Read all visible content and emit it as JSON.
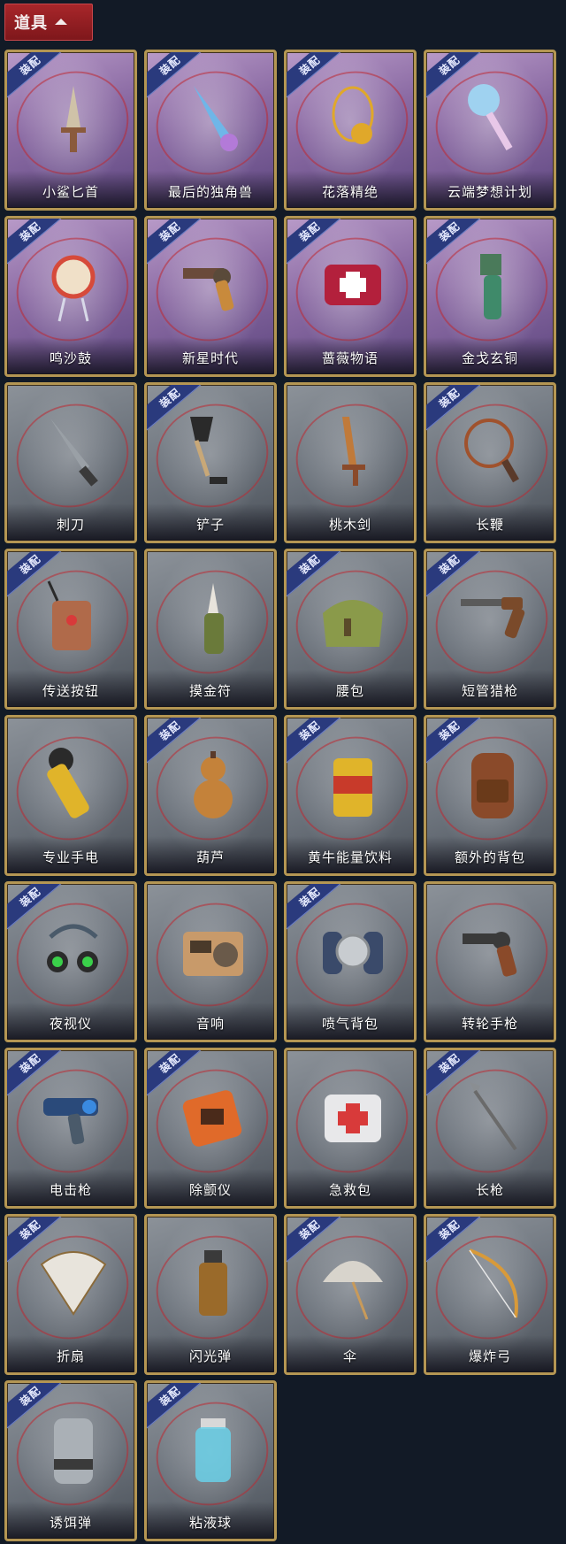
{
  "header": {
    "title": "道具"
  },
  "equip_label": "装配",
  "items": [
    {
      "name": "小鲨匕首",
      "equipped": true,
      "style": "purple",
      "icon": "dagger-icon",
      "color": "#8a5a3c"
    },
    {
      "name": "最后的独角兽",
      "equipped": true,
      "style": "purple",
      "icon": "unicorn-horn-icon",
      "color": "#6fb6e8"
    },
    {
      "name": "花落精绝",
      "equipped": true,
      "style": "purple",
      "icon": "flower-necklace-icon",
      "color": "#e0a82a"
    },
    {
      "name": "云端梦想计划",
      "equipped": true,
      "style": "purple",
      "icon": "scepter-icon",
      "color": "#9fd2f0"
    },
    {
      "name": "鸣沙鼓",
      "equipped": true,
      "style": "purple",
      "icon": "drum-icon",
      "color": "#d64a3a"
    },
    {
      "name": "新星时代",
      "equipped": true,
      "style": "purple",
      "icon": "revolver-icon",
      "color": "#c88a3c"
    },
    {
      "name": "蔷薇物语",
      "equipped": true,
      "style": "purple",
      "icon": "medkit-icon",
      "color": "#b3203c"
    },
    {
      "name": "金戈玄铜",
      "equipped": true,
      "style": "purple",
      "icon": "bronze-grenade-icon",
      "color": "#3f8a6a"
    },
    {
      "name": "刺刀",
      "equipped": false,
      "style": "grey",
      "icon": "bayonet-icon",
      "color": "#9aa0a6"
    },
    {
      "name": "铲子",
      "equipped": true,
      "style": "grey",
      "icon": "shovel-icon",
      "color": "#2d2d2d"
    },
    {
      "name": "桃木剑",
      "equipped": false,
      "style": "grey",
      "icon": "wooden-sword-icon",
      "color": "#c07a3a"
    },
    {
      "name": "长鞭",
      "equipped": true,
      "style": "grey",
      "icon": "whip-icon",
      "color": "#a0522d"
    },
    {
      "name": "传送按钮",
      "equipped": true,
      "style": "grey",
      "icon": "remote-icon",
      "color": "#b06a4a"
    },
    {
      "name": "摸金符",
      "equipped": false,
      "style": "grey",
      "icon": "talisman-icon",
      "color": "#6a7a3a"
    },
    {
      "name": "腰包",
      "equipped": true,
      "style": "grey",
      "icon": "waist-bag-icon",
      "color": "#8a9a4a"
    },
    {
      "name": "短管猎枪",
      "equipped": true,
      "style": "grey",
      "icon": "shotgun-icon",
      "color": "#7a4a2a"
    },
    {
      "name": "专业手电",
      "equipped": false,
      "style": "grey",
      "icon": "flashlight-icon",
      "color": "#e0b42a"
    },
    {
      "name": "葫芦",
      "equipped": true,
      "style": "grey",
      "icon": "gourd-icon",
      "color": "#c4823a"
    },
    {
      "name": "黄牛能量饮料",
      "equipped": true,
      "style": "grey",
      "icon": "energy-drink-icon",
      "color": "#e0b42a"
    },
    {
      "name": "额外的背包",
      "equipped": true,
      "style": "grey",
      "icon": "backpack-icon",
      "color": "#8a4a2a"
    },
    {
      "name": "夜视仪",
      "equipped": true,
      "style": "grey",
      "icon": "night-vision-icon",
      "color": "#3ad04a"
    },
    {
      "name": "音响",
      "equipped": false,
      "style": "grey",
      "icon": "radio-icon",
      "color": "#c89a6a"
    },
    {
      "name": "喷气背包",
      "equipped": true,
      "style": "grey",
      "icon": "jetpack-icon",
      "color": "#3a4a6a"
    },
    {
      "name": "转轮手枪",
      "equipped": false,
      "style": "grey",
      "icon": "pistol-icon",
      "color": "#8a4a2a"
    },
    {
      "name": "电击枪",
      "equipped": true,
      "style": "grey",
      "icon": "taser-icon",
      "color": "#3a8ae0"
    },
    {
      "name": "除颤仪",
      "equipped": true,
      "style": "grey",
      "icon": "defibrillator-icon",
      "color": "#e06a2a"
    },
    {
      "name": "急救包",
      "equipped": false,
      "style": "grey",
      "icon": "first-aid-icon",
      "color": "#d83a3a"
    },
    {
      "name": "长枪",
      "equipped": true,
      "style": "grey",
      "icon": "spear-icon",
      "color": "#6a6a6a"
    },
    {
      "name": "折扇",
      "equipped": true,
      "style": "grey",
      "icon": "folding-fan-icon",
      "color": "#e8e4dc"
    },
    {
      "name": "闪光弹",
      "equipped": false,
      "style": "grey",
      "icon": "flashbang-icon",
      "color": "#9a6a2a"
    },
    {
      "name": "伞",
      "equipped": true,
      "style": "grey",
      "icon": "umbrella-icon",
      "color": "#d8d4cc"
    },
    {
      "name": "爆炸弓",
      "equipped": true,
      "style": "grey",
      "icon": "bow-icon",
      "color": "#d89a3a"
    },
    {
      "name": "诱饵弹",
      "equipped": true,
      "style": "grey",
      "icon": "decoy-grenade-icon",
      "color": "#aab0b6"
    },
    {
      "name": "粘液球",
      "equipped": true,
      "style": "grey",
      "icon": "slime-jar-icon",
      "color": "#6ad0e8"
    }
  ]
}
